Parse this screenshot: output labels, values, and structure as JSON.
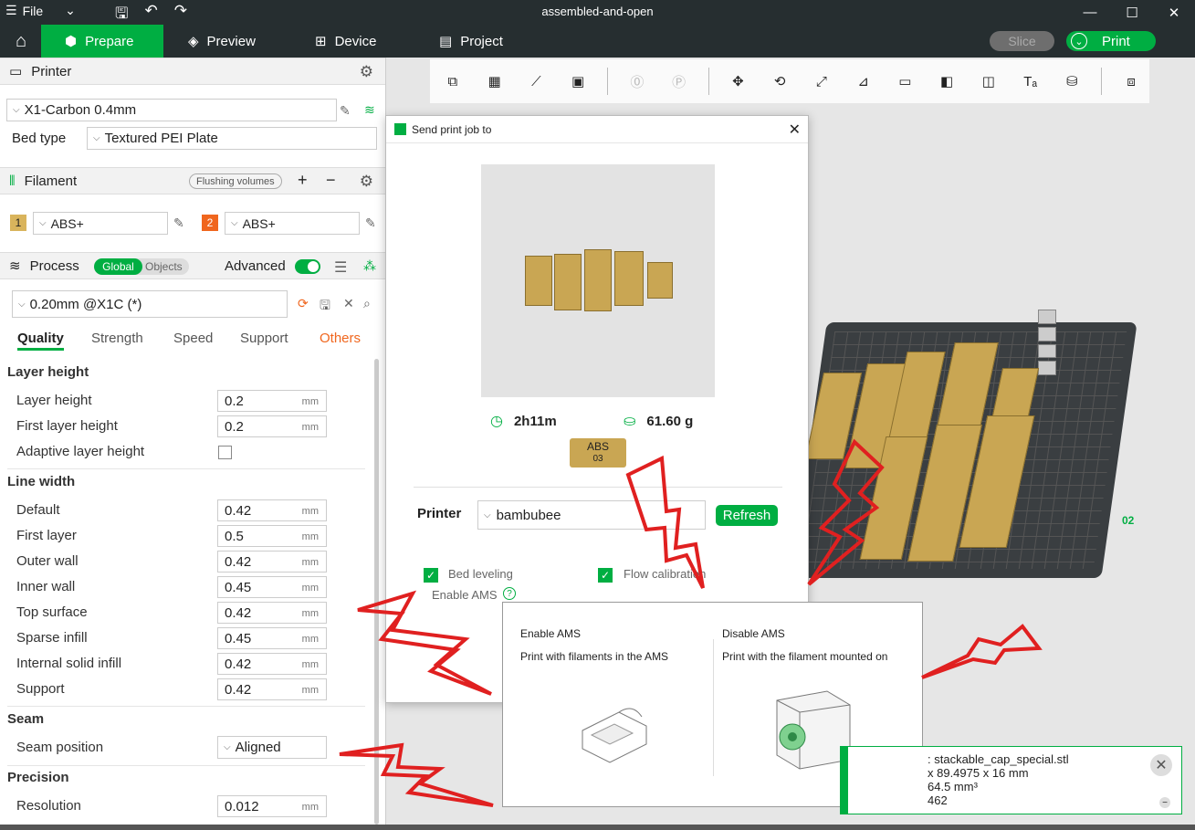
{
  "titlebar": {
    "menu_label": "File",
    "title": "assembled-and-open"
  },
  "tabs": {
    "prepare": "Prepare",
    "preview": "Preview",
    "device": "Device",
    "project": "Project",
    "slice": "Slice",
    "print": "Print"
  },
  "printer": {
    "section_title": "Printer",
    "model": "X1-Carbon 0.4mm",
    "bed_type_label": "Bed type",
    "bed_type": "Textured PEI Plate"
  },
  "filament": {
    "section_title": "Filament",
    "flushing_label": "Flushing volumes",
    "slots": [
      {
        "num": "1",
        "name": "ABS+",
        "color": "#d9b45c"
      },
      {
        "num": "2",
        "name": "ABS+",
        "color": "#f0661e"
      }
    ]
  },
  "process": {
    "section_title": "Process",
    "global_label": "Global",
    "objects_label": "Objects",
    "advanced_label": "Advanced",
    "preset": "0.20mm @X1C (*)",
    "tabs": [
      "Quality",
      "Strength",
      "Speed",
      "Support",
      "Others"
    ]
  },
  "quality": {
    "layer_height": {
      "title": "Layer height",
      "rows": [
        {
          "label": "Layer height",
          "value": "0.2",
          "unit": "mm"
        },
        {
          "label": "First layer height",
          "value": "0.2",
          "unit": "mm"
        }
      ],
      "adaptive_label": "Adaptive layer height"
    },
    "line_width": {
      "title": "Line width",
      "rows": [
        {
          "label": "Default",
          "value": "0.42",
          "unit": "mm"
        },
        {
          "label": "First layer",
          "value": "0.5",
          "unit": "mm"
        },
        {
          "label": "Outer wall",
          "value": "0.42",
          "unit": "mm"
        },
        {
          "label": "Inner wall",
          "value": "0.45",
          "unit": "mm"
        },
        {
          "label": "Top surface",
          "value": "0.42",
          "unit": "mm"
        },
        {
          "label": "Sparse infill",
          "value": "0.45",
          "unit": "mm"
        },
        {
          "label": "Internal solid infill",
          "value": "0.42",
          "unit": "mm"
        },
        {
          "label": "Support",
          "value": "0.42",
          "unit": "mm"
        }
      ]
    },
    "seam": {
      "title": "Seam",
      "label": "Seam position",
      "value": "Aligned"
    },
    "precision": {
      "title": "Precision",
      "label": "Resolution",
      "value": "0.012",
      "unit": "mm"
    }
  },
  "plate": {
    "label": "02"
  },
  "dialog": {
    "title": "Send print job to",
    "time": "2h11m",
    "weight": "61.60 g",
    "ams_chip_name": "ABS",
    "ams_chip_slot": "03",
    "printer_label": "Printer",
    "printer_value": "bambubee",
    "refresh_label": "Refresh",
    "bed_leveling": "Bed leveling",
    "flow_calibration": "Flow calibration",
    "enable_ams": "Enable AMS",
    "help_glyph": "?"
  },
  "ams_tooltip": {
    "enable_title": "Enable AMS",
    "enable_desc": "Print with filaments in the AMS",
    "disable_title": "Disable AMS",
    "disable_desc": "Print with the filament mounted on"
  },
  "notification": {
    "line1": ": stackable_cap_special.stl",
    "line2": "x 89.4975 x 16 mm",
    "line3": "64.5 mm³",
    "line4": "462"
  },
  "colors": {
    "accent": "#00ae42",
    "dark_bar": "#262e30",
    "model": "#c9a653"
  }
}
